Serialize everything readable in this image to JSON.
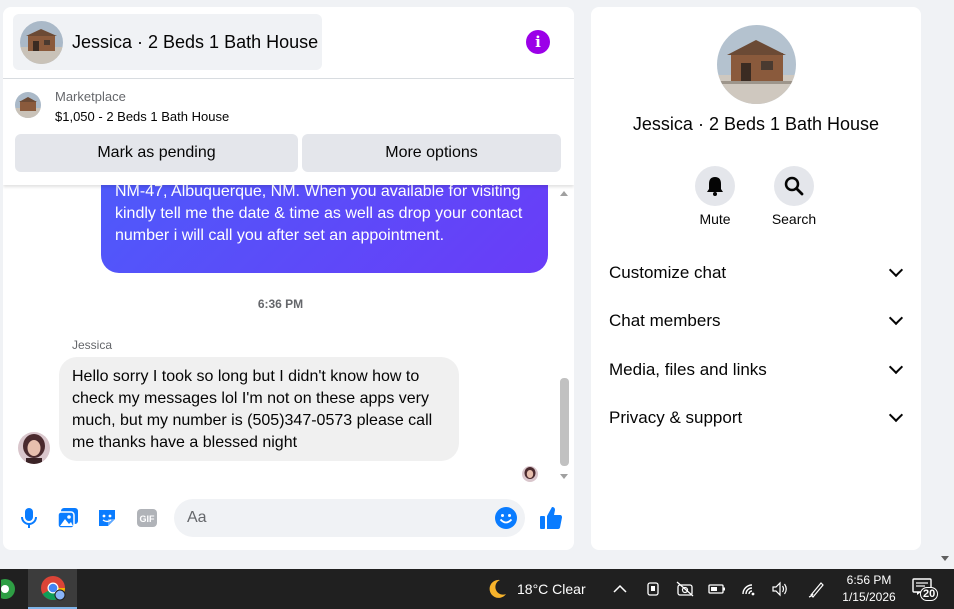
{
  "chat": {
    "title": "Jessica · 2 Beds 1 Bath House",
    "listing": {
      "source": "Marketplace",
      "price_title": "$1,050 - 2 Beds 1 Bath House"
    },
    "actions": {
      "mark_pending": "Mark as pending",
      "more_options": "More options"
    },
    "messages": {
      "outgoing_text": "NM-47, Albuquerque, NM. When you available for visiting kindly tell me the date & time as well as drop your contact number i will call you after set an appointment.",
      "timestamp": "6:36 PM",
      "sender": "Jessica",
      "incoming_text": "Hello sorry I took so long but I didn't know how to check my messages lol I'm not on these apps very much, but my number is (505)347-0573 please call me thanks have a blessed night"
    },
    "composer": {
      "placeholder": "Aa",
      "icons": [
        "microphone-icon",
        "photo-icon",
        "sticker-icon",
        "gif-icon",
        "emoji-icon",
        "thumbs-up-icon"
      ]
    }
  },
  "info_panel": {
    "title": "Jessica · 2 Beds 1 Bath House",
    "mute_label": "Mute",
    "search_label": "Search",
    "sections": [
      "Customize chat",
      "Chat members",
      "Media, files and links",
      "Privacy & support"
    ]
  },
  "taskbar": {
    "weather": "18°C  Clear",
    "time": "6:56 PM",
    "date": "1/15/2026",
    "notification_count": "20"
  },
  "colors": {
    "accent": "#0a7cff",
    "outgoing_bubble": "#5b4cf9",
    "info_icon": "#9b00e8"
  }
}
